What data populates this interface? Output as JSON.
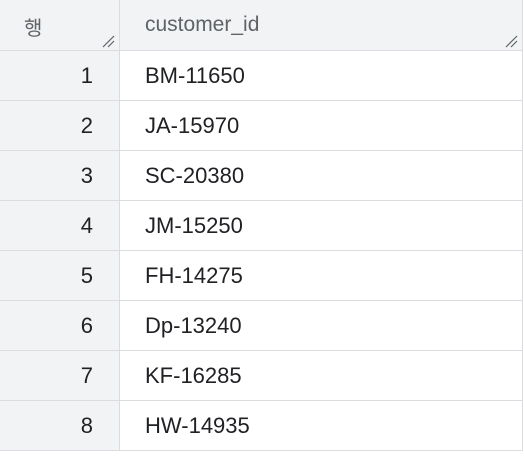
{
  "table": {
    "rownum_header": "행",
    "column_header": "customer_id",
    "rows": [
      {
        "num": "1",
        "customer_id": "BM-11650"
      },
      {
        "num": "2",
        "customer_id": "JA-15970"
      },
      {
        "num": "3",
        "customer_id": "SC-20380"
      },
      {
        "num": "4",
        "customer_id": "JM-15250"
      },
      {
        "num": "5",
        "customer_id": "FH-14275"
      },
      {
        "num": "6",
        "customer_id": "Dp-13240"
      },
      {
        "num": "7",
        "customer_id": "KF-16285"
      },
      {
        "num": "8",
        "customer_id": "HW-14935"
      }
    ]
  },
  "icons": {
    "resize": "column-resize-icon"
  },
  "colors": {
    "header_bg": "#f1f3f4",
    "border": "#dadce0",
    "text": "#202124",
    "header_text": "#5f6368"
  }
}
